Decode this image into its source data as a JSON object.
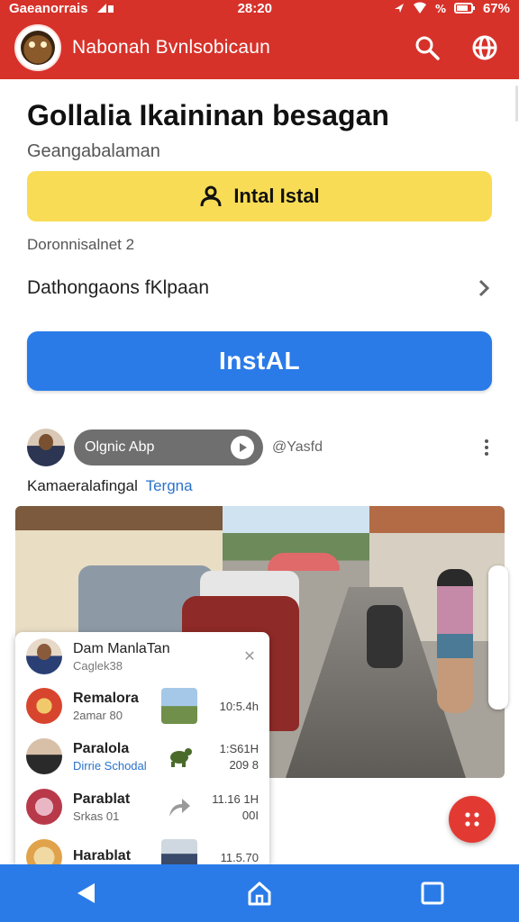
{
  "status_bar": {
    "left_text": "Gaeanorrais",
    "time": "28:20",
    "battery": "67%"
  },
  "app_bar": {
    "title": "Nabonah Bvnlsobicaun",
    "icons": [
      "app-logo",
      "search-icon",
      "globe-icon"
    ]
  },
  "header": {
    "title": "Gollalia Ikaininan besagan",
    "subtitle": "Geangabalaman"
  },
  "install_yellow": {
    "label": "Intal Istal",
    "icon": "person-icon",
    "color": "#f8dc55"
  },
  "meta_line": "Doronnisalnet 2",
  "row_link": {
    "label": "Dathongaons fKlpaan",
    "icon": "chevron-right-icon"
  },
  "install_blue": {
    "label": "InstAL",
    "color": "#2a7be8"
  },
  "post": {
    "pill_label": "Olgnic Abp",
    "handle": "@Yasfd",
    "caption": "Kamaeralafingal",
    "caption_tag": "Tergna"
  },
  "chat": {
    "header": {
      "name": "Dam ManlaTan",
      "sub": "Caglek38"
    },
    "rows": [
      {
        "name": "Remalora",
        "sub": "2amar 80",
        "time1": "10:5.4h",
        "time2": ""
      },
      {
        "name": "Paralola",
        "sub": "Dirrie Schodal",
        "time1": "1:S61H",
        "time2": "209 8"
      },
      {
        "name": "Parablat",
        "sub": "Srkas 01",
        "time1": "11.16 1H",
        "time2": "00I"
      },
      {
        "name": "Harablat",
        "sub": "",
        "time1": "11.5.70",
        "time2": ""
      }
    ]
  },
  "colors": {
    "brand_red": "#d6322a",
    "accent_blue": "#2a7be8",
    "accent_yellow": "#f8dc55",
    "fab_red": "#e23a33"
  },
  "nav": {
    "icons": [
      "back-icon",
      "home-icon",
      "recents-icon"
    ]
  }
}
